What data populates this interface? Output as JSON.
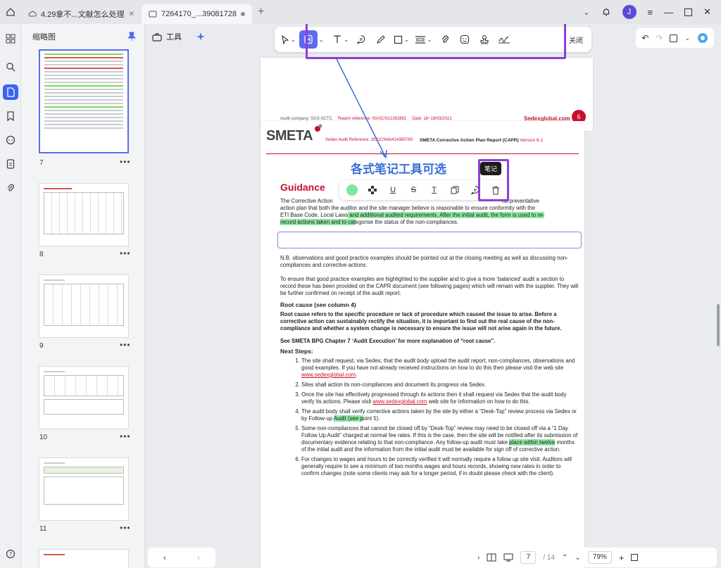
{
  "tabs": [
    {
      "label": "4.29拿不...文献怎么处理",
      "icon": "cloud-icon"
    },
    {
      "label": "7264170_...39081728",
      "icon": "document-icon"
    }
  ],
  "avatar_letter": "J",
  "sidebar": {
    "title": "缩略图"
  },
  "thumbnails": [
    {
      "label": "7"
    },
    {
      "label": "8"
    },
    {
      "label": "9"
    },
    {
      "label": "10"
    },
    {
      "label": "11"
    }
  ],
  "tools": {
    "label": "工具"
  },
  "toolbar": {
    "close_label": "关闭"
  },
  "page_top": {
    "audit_company": "Audit company:  SGS-SCTC",
    "report_ref": "Report reference:  ISASCN21392891",
    "date": "Date:  18~19/03/2021",
    "site": "Sedexglobal.com",
    "page_number": "6"
  },
  "page_main": {
    "logo": "SMETA",
    "audit_ref": "Sedex Audit Reference: 2021CN4A414380760",
    "report_title": "SMETA Corrective Action Plan Report (CAPR)",
    "version": "Version 6.1",
    "overlay_title": "各式笔记工具可选",
    "tooltip": "笔记",
    "guidance": "Guidance",
    "p1_a": "The Corrective Action",
    "p1_b": "nd preventative",
    "p1_c": "action plan that both the auditor and the site manager believe is reasonable to ensure conformity with the",
    "p1_d": "ETI Base Code, Local Laws",
    "p1_e": " and additional audited requirements. After the initial audit, the form is used to re-",
    "p1_f": "record actions taken and to cat",
    "p1_g": "egorise the status of the non-compliances.",
    "p2": "N.B. observations and good practice examples should be pointed out at the closing meeting as well as discussing non-compliances and corrective actions.",
    "p3": "To ensure that good practice examples are highlighted to the supplier and to give a more ‘balanced’ audit a section to record these has been provided on the CAPR document (see following pages) which will remain with the supplier. They will be further confirmed on receipt of the audit report.",
    "h_root": "Root cause (see column 4)",
    "p4": "Root cause refers to the specific procedure or lack of procedure which caused the issue to arise. Before a corrective action can sustainably rectify the situation, it is important to find out the real cause of the non-compliance and whether a system change is necessary to ensure the issue will not arise again in the future.",
    "p5": "See SMETA BPG Chapter 7 ‘Audit Execution’ for more explanation of “root cause”.",
    "h_next": "Next Steps:",
    "s1": "The site shall request, via Sedex, that the audit body upload the audit report, non-compliances, observations and good examples. If you have not already received instructions on how to do this then please visit the web site ",
    "s1_link": "www.sedexglobal.com",
    "s2": "Sites shall action its non-compliances and document its progress via Sedex.",
    "s3": "Once the site has effectively progressed through its actions then it shall request via Sedex that the audit body verify its actions. Please visit ",
    "s3_link": "www.sedexglobal.com",
    "s3_b": " web site for information on how to do this.",
    "s4_a": "The audit body shall verify corrective actions taken by the site by either a “Desk-Top” review process via Sedex or by Follow-up ",
    "s4_hl": "Audit (see p",
    "s4_b": "oint 5).",
    "s5_a": "Some non-compliances that cannot be closed off by “Desk-Top” review may need to be closed off via a “1 Day Follow Up Audit” charged at normal fee rates. If this is the case, then the site will be notified after its submission of documentary evidence relating to that non-compliance. Any follow-up audit must take ",
    "s5_hl": "place within twelve",
    "s5_b": " months of the initial audit and the information from the initial audit must be available for sign off of corrective action.",
    "s6": "For changes to wages and hours to be correctly verified it will normally require a follow up site visit. Auditors will generally require to see a minimum of two months wages and hours records, showing new rates in order to confirm changes (note some clients may ask for a longer period, if in doubt please check with the client)."
  },
  "pager": {
    "current": "7",
    "total": "/ 14",
    "zoom": "79%"
  },
  "colors": {
    "accent": "#5b6cf0",
    "highlight_box": "#8e3fd8",
    "brand_red": "#c8102e",
    "highlight_green": "#8fe8a6",
    "overlay_blue": "#3a6fd8"
  }
}
